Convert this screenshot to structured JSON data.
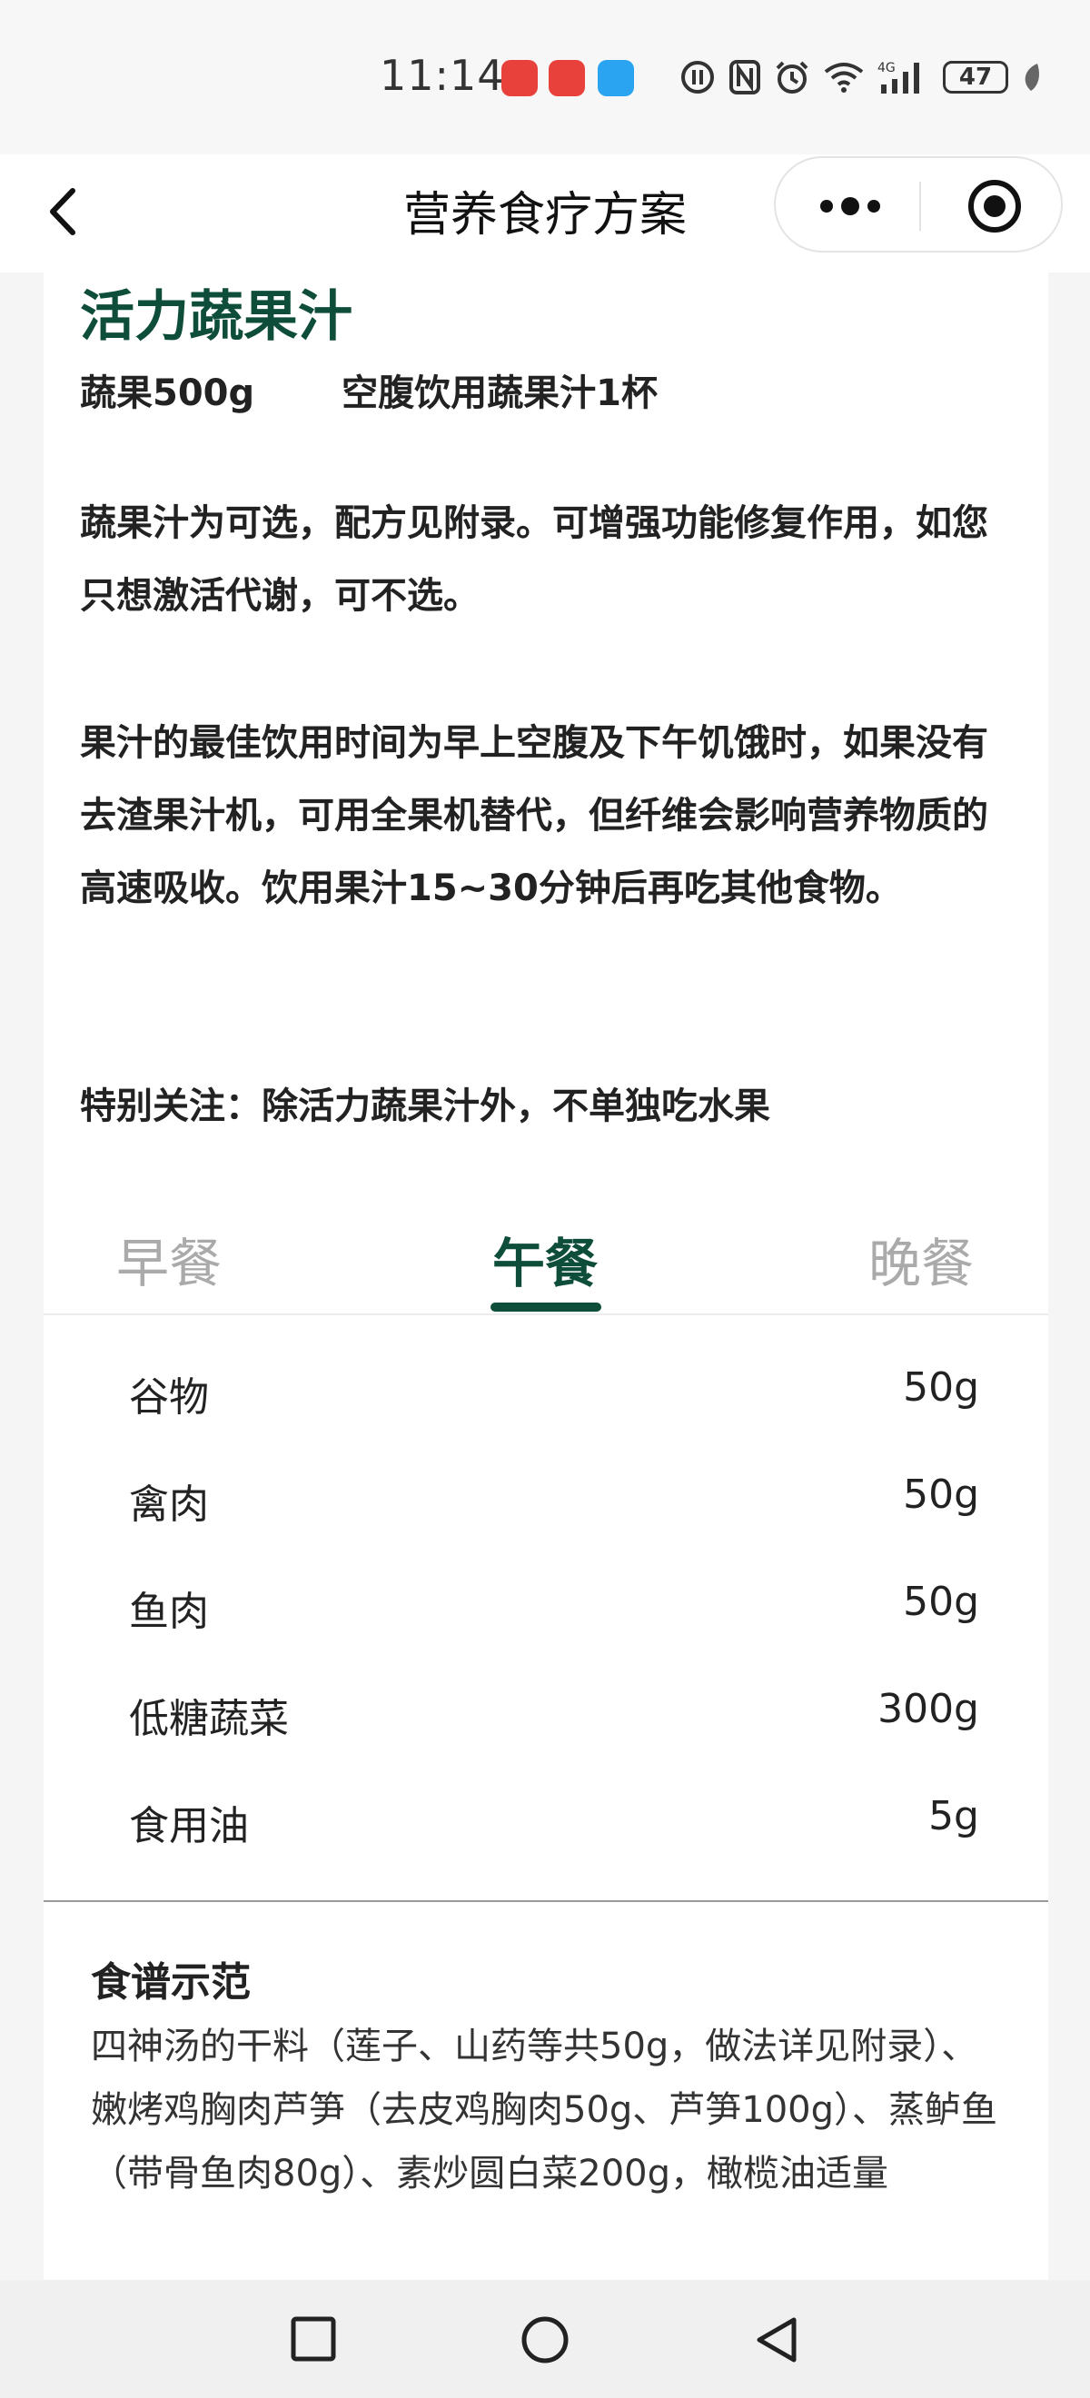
{
  "status_bar": {
    "time": "11:14",
    "battery": "47",
    "icons": [
      "huawei-app-icon",
      "huawei-app-icon",
      "message-icon",
      "hd-icon",
      "nfc-icon",
      "alarm-icon",
      "wifi-icon",
      "signal-4g-icon",
      "battery-icon",
      "leaf-icon"
    ]
  },
  "nav": {
    "title": "营养食疗方案",
    "back_icon": "chevron-left-icon",
    "more_icon": "more-dots-icon",
    "close_icon": "target-circle-icon"
  },
  "juice": {
    "title": "活力蔬果汁",
    "amount": "蔬果500g",
    "instruction": "空腹饮用蔬果汁1杯"
  },
  "paragraphs": {
    "p1": "蔬果汁为可选，配方见附录。可增强功能修复作用，如您只想激活代谢，可不选。",
    "p2": "果汁的最佳饮用时间为早上空腹及下午饥饿时，如果没有去渣果汁机，可用全果机替代，但纤维会影响营养物质的高速吸收。饮用果汁15~30分钟后再吃其他食物。",
    "p3": "特别关注：除活力蔬果汁外，不单独吃水果"
  },
  "tabs": [
    {
      "label": "早餐",
      "active": false
    },
    {
      "label": "午餐",
      "active": true
    },
    {
      "label": "晚餐",
      "active": false
    }
  ],
  "foods": [
    {
      "name": "谷物",
      "amount": "50g"
    },
    {
      "name": "禽肉",
      "amount": "50g"
    },
    {
      "name": "鱼肉",
      "amount": "50g"
    },
    {
      "name": "低糖蔬菜",
      "amount": "300g"
    },
    {
      "name": "食用油",
      "amount": "5g"
    }
  ],
  "recipe": {
    "title": "食谱示范",
    "body": "四神汤的干料（莲子、山药等共50g，做法详见附录）、嫩烤鸡胸肉芦笋（去皮鸡胸肉50g、芦笋100g）、蒸鲈鱼（带骨鱼肉80g）、素炒圆白菜200g，橄榄油适量"
  },
  "colors": {
    "accent": "#0e4d3a",
    "inactive_tab": "#aaaaaa",
    "huawei_red": "#e8413c",
    "message_blue": "#2aa3f0"
  },
  "android_nav": [
    "square-recents-icon",
    "circle-home-icon",
    "triangle-back-icon"
  ]
}
